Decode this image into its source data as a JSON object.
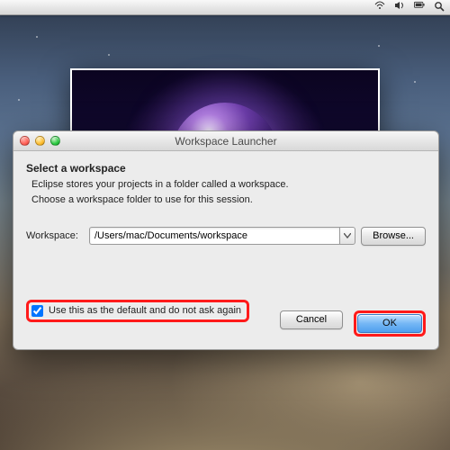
{
  "menubar": {
    "icons": [
      "wifi",
      "volume",
      "battery",
      "spotlight"
    ]
  },
  "splash": {
    "alt": "Eclipse splash"
  },
  "dialog": {
    "title": "Workspace Launcher",
    "heading": "Select a workspace",
    "desc_line1": "Eclipse stores your projects in a folder called a workspace.",
    "desc_line2": "Choose a workspace folder to use for this session.",
    "workspace_label": "Workspace:",
    "workspace_value": "/Users/mac/Documents/workspace",
    "browse_label": "Browse...",
    "checkbox_label": "Use this as the default and do not ask again",
    "checkbox_checked": true,
    "cancel_label": "Cancel",
    "ok_label": "OK"
  },
  "highlights": {
    "checkbox": true,
    "ok_button": true
  }
}
